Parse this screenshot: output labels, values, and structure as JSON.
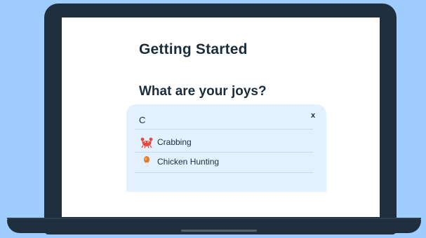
{
  "page": {
    "title": "Getting Started",
    "question": "What are your joys?"
  },
  "search": {
    "value": "C",
    "clear_label": "x"
  },
  "results": [
    {
      "label": "Crabbing",
      "icon": "crab-icon"
    },
    {
      "label": "Chicken Hunting",
      "icon": "chicken-leg-icon"
    }
  ],
  "colors": {
    "background": "#9fcdff",
    "laptop": "#1f2f3e",
    "panel": "#e3f1ff",
    "text": "#1b2d3d"
  }
}
